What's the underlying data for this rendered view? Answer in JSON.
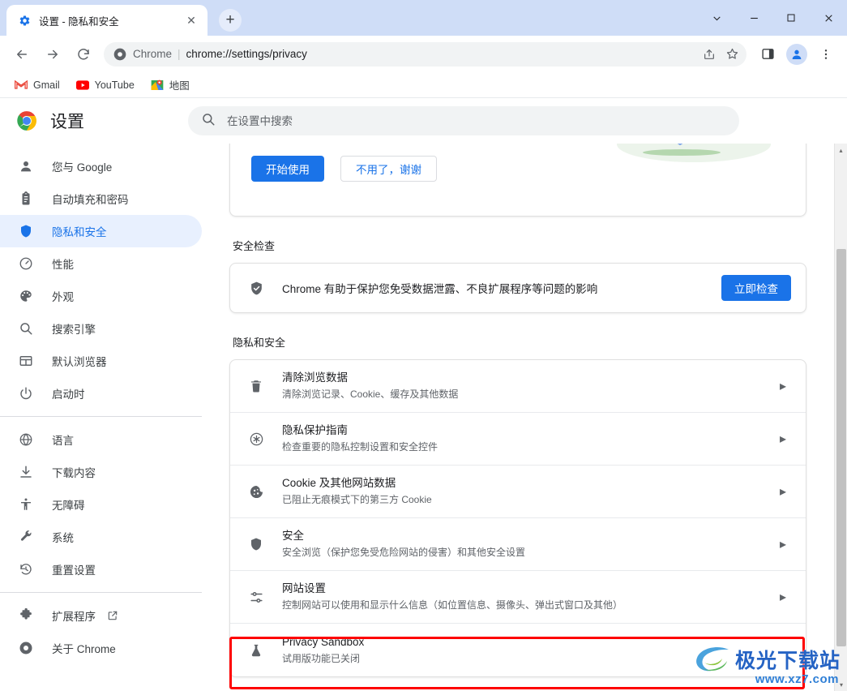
{
  "browser": {
    "tab": {
      "title": "设置 - 隐私和安全",
      "favicon": "gear-icon",
      "close_label": "✕"
    },
    "new_tab_label": "+",
    "window_controls": {
      "chevron": "⌄",
      "minimize": "—",
      "maximize": "▢",
      "close": "✕"
    },
    "toolbar": {
      "back_label": "←",
      "forward_label": "→",
      "reload_label": "⟳",
      "omnibox": {
        "scheme_label": "Chrome",
        "separator": "|",
        "url": "chrome://settings/privacy"
      },
      "share_label": "share-icon",
      "bookmark_label": "star-icon",
      "sidepanel_label": "side-panel-icon",
      "profile_label": "profile-avatar",
      "menu_label": "⋮"
    },
    "bookmarks": [
      {
        "label": "Gmail",
        "icon": "gmail-icon"
      },
      {
        "label": "YouTube",
        "icon": "youtube-icon"
      },
      {
        "label": "地图",
        "icon": "maps-icon"
      }
    ]
  },
  "settings": {
    "title": "设置",
    "search": {
      "placeholder": "在设置中搜索",
      "value": "",
      "icon": "search-icon"
    },
    "sidebar": {
      "groups": [
        {
          "items": [
            {
              "label": "您与 Google",
              "icon": "person-icon",
              "selected": false
            },
            {
              "label": "自动填充和密码",
              "icon": "clipboard-icon",
              "selected": false
            },
            {
              "label": "隐私和安全",
              "icon": "shield-icon",
              "selected": true
            },
            {
              "label": "性能",
              "icon": "speedometer-icon",
              "selected": false
            },
            {
              "label": "外观",
              "icon": "palette-icon",
              "selected": false
            },
            {
              "label": "搜索引擎",
              "icon": "search-icon",
              "selected": false
            },
            {
              "label": "默认浏览器",
              "icon": "browser-window-icon",
              "selected": false
            },
            {
              "label": "启动时",
              "icon": "power-icon",
              "selected": false
            }
          ]
        },
        {
          "items": [
            {
              "label": "语言",
              "icon": "globe-icon",
              "selected": false
            },
            {
              "label": "下载内容",
              "icon": "download-icon",
              "selected": false
            },
            {
              "label": "无障碍",
              "icon": "accessibility-icon",
              "selected": false
            },
            {
              "label": "系统",
              "icon": "wrench-icon",
              "selected": false
            },
            {
              "label": "重置设置",
              "icon": "history-restore-icon",
              "selected": false
            }
          ]
        },
        {
          "items": [
            {
              "label": "扩展程序",
              "icon": "puzzle-icon",
              "selected": false,
              "external": true
            },
            {
              "label": "关于 Chrome",
              "icon": "chrome-icon",
              "selected": false
            }
          ]
        }
      ]
    },
    "promo_card": {
      "primary_button": "开始使用",
      "secondary_button": "不用了，谢谢",
      "illustration": "shield-magnifier-illustration"
    },
    "safety_check": {
      "section_title": "安全检查",
      "icon": "shield-check-icon",
      "description": "Chrome 有助于保护您免受数据泄露、不良扩展程序等问题的影响",
      "button_label": "立即检查"
    },
    "privacy_section": {
      "section_title": "隐私和安全",
      "rows": [
        {
          "icon": "trash-icon",
          "title": "清除浏览数据",
          "subtitle": "清除浏览记录、Cookie、缓存及其他数据",
          "arrow": "▸",
          "highlighted": false
        },
        {
          "icon": "privacy-guide-icon",
          "title": "隐私保护指南",
          "subtitle": "检查重要的隐私控制设置和安全控件",
          "arrow": "▸",
          "highlighted": false
        },
        {
          "icon": "cookie-icon",
          "title": "Cookie 及其他网站数据",
          "subtitle": "已阻止无痕模式下的第三方 Cookie",
          "arrow": "▸",
          "highlighted": false
        },
        {
          "icon": "shield-icon",
          "title": "安全",
          "subtitle": "安全浏览（保护您免受危险网站的侵害）和其他安全设置",
          "arrow": "▸",
          "highlighted": false
        },
        {
          "icon": "sliders-icon",
          "title": "网站设置",
          "subtitle": "控制网站可以使用和显示什么信息（如位置信息、摄像头、弹出式窗口及其他）",
          "arrow": "▸",
          "highlighted": false
        },
        {
          "icon": "flask-icon",
          "title": "Privacy Sandbox",
          "subtitle": "试用版功能已关闭",
          "arrow": "",
          "highlighted": true
        }
      ]
    }
  },
  "annotation": {
    "highlight_color": "#fe0000",
    "target": "Privacy Sandbox"
  },
  "watermark": {
    "text": "极光下载站",
    "url": "www.xz7.com"
  },
  "colors": {
    "accent_blue": "#1a73e8",
    "tabstrip_blue": "#cfddf7",
    "selected_nav_bg": "#e8f0fe",
    "text_primary": "#202124",
    "text_secondary": "#5f6368",
    "highlight_red": "#fe0000"
  },
  "scrollbar": {
    "up_arrow": "▴",
    "down_arrow": "▾"
  }
}
